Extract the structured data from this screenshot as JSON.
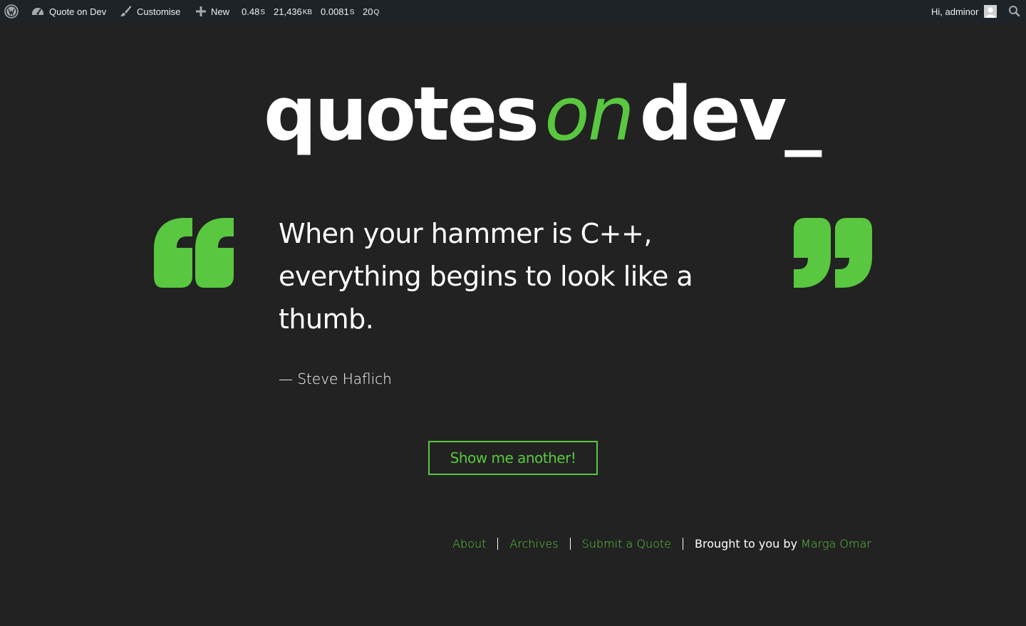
{
  "admin_bar": {
    "site_name": "Quote on Dev",
    "customise_label": "Customise",
    "new_label": "New",
    "metrics": [
      {
        "value": "0.48",
        "unit": "S"
      },
      {
        "value": "21,436",
        "unit": "KB"
      },
      {
        "value": "0.0081",
        "unit": "S"
      },
      {
        "value": "20",
        "unit": "Q"
      }
    ],
    "greeting": "Hi, adminor"
  },
  "site_title": {
    "part1": "quotes",
    "part2": "on",
    "part3": "dev_"
  },
  "quote": {
    "text": "When your hammer is C++, everything begins to look like a thumb.",
    "author": "— Steve Haflich"
  },
  "button": {
    "label": "Show me another!"
  },
  "footer": {
    "links": [
      "About",
      "Archives",
      "Submit a Quote"
    ],
    "credit_prefix": "Brought to you by",
    "credit_name": "Marga Omar"
  },
  "colors": {
    "background": "#222222",
    "accent": "#59c73f",
    "adminbar": "#1d2327",
    "text": "#ffffff"
  }
}
